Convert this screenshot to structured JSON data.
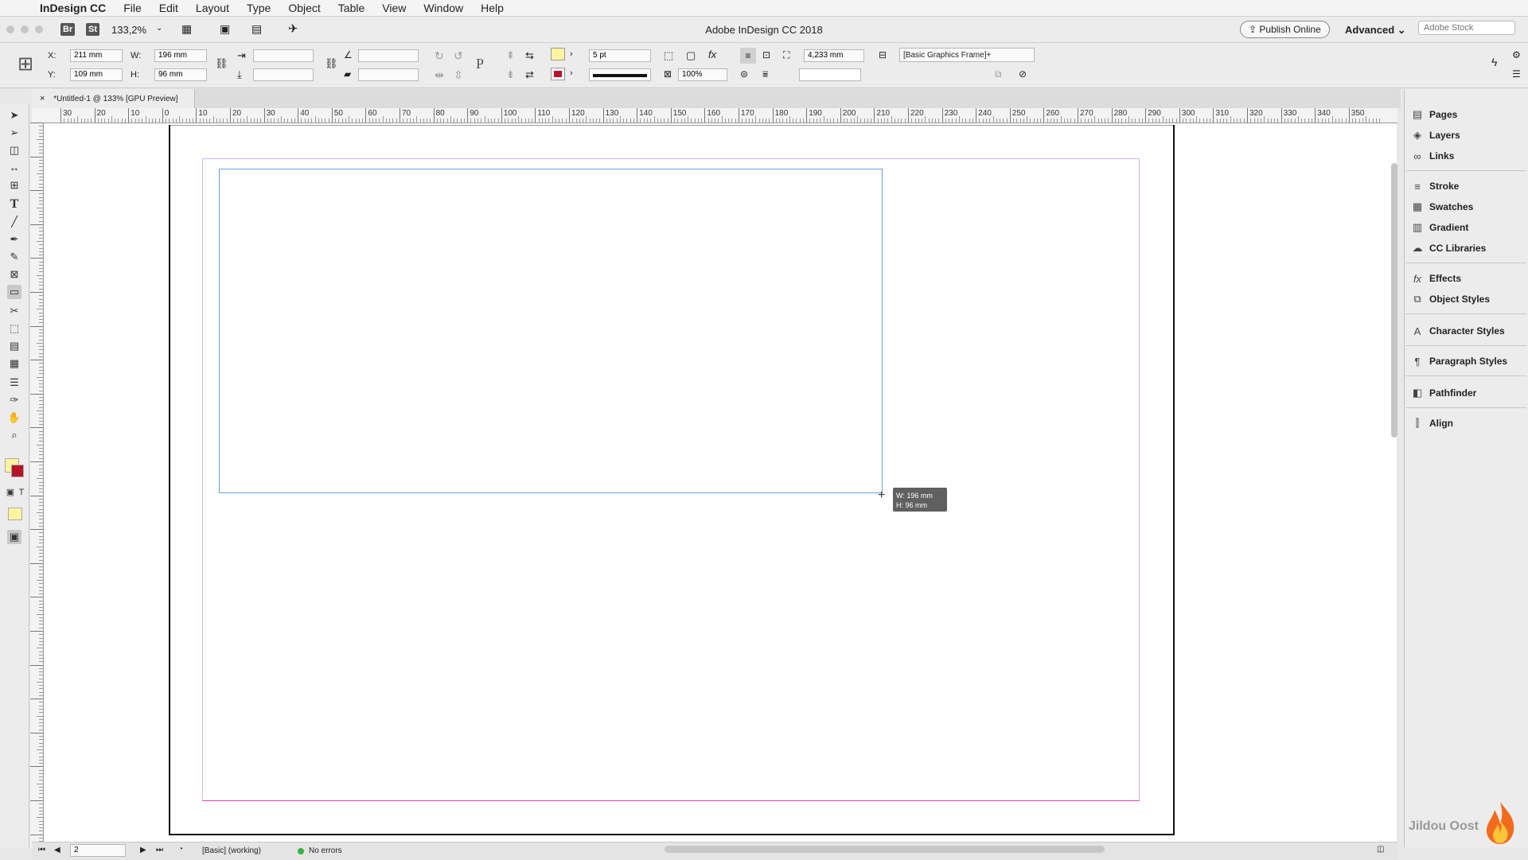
{
  "menubar": {
    "app_name": "InDesign CC",
    "items": [
      "File",
      "Edit",
      "Layout",
      "Type",
      "Object",
      "Table",
      "View",
      "Window",
      "Help"
    ]
  },
  "appbar": {
    "bridge_label": "Br",
    "stock_label": "St",
    "zoom": "133,2%",
    "window_title": "Adobe InDesign CC 2018",
    "publish_label": "Publish Online",
    "workspace": "Advanced",
    "search_placeholder": "Adobe Stock"
  },
  "control": {
    "x_label": "X:",
    "x_value": "211 mm",
    "y_label": "Y:",
    "y_value": "109 mm",
    "w_label": "W:",
    "w_value": "196 mm",
    "h_label": "H:",
    "h_value": "96 mm",
    "stroke_weight": "5 pt",
    "opacity": "100%",
    "offset": "4,233 mm",
    "object_style": "[Basic Graphics Frame]+",
    "fill_color": "#fff3a0",
    "stroke_color": "#b3142a"
  },
  "document": {
    "tab_label": "*Untitled-1 @ 133% [GPU Preview]",
    "ruler_labels": [
      "30",
      "20",
      "10",
      "0",
      "10",
      "20",
      "30",
      "40",
      "50",
      "60",
      "70",
      "80",
      "90",
      "100",
      "110",
      "120",
      "130",
      "140",
      "150",
      "160",
      "170",
      "180",
      "190",
      "200",
      "210",
      "220",
      "230",
      "240",
      "250",
      "260",
      "270",
      "280",
      "290",
      "300",
      "310",
      "320",
      "330",
      "340",
      "350"
    ],
    "tooltip_w": "W: 196 mm",
    "tooltip_h": "H: 96 mm"
  },
  "panels": {
    "items": [
      "Pages",
      "Layers",
      "Links",
      "Stroke",
      "Swatches",
      "Gradient",
      "CC Libraries",
      "Effects",
      "Object Styles",
      "Character Styles",
      "Paragraph Styles",
      "Pathfinder",
      "Align"
    ]
  },
  "status": {
    "page": "2",
    "preflight_profile": "[Basic] (working)",
    "errors": "No errors"
  },
  "watermark": "Jildou Oost"
}
